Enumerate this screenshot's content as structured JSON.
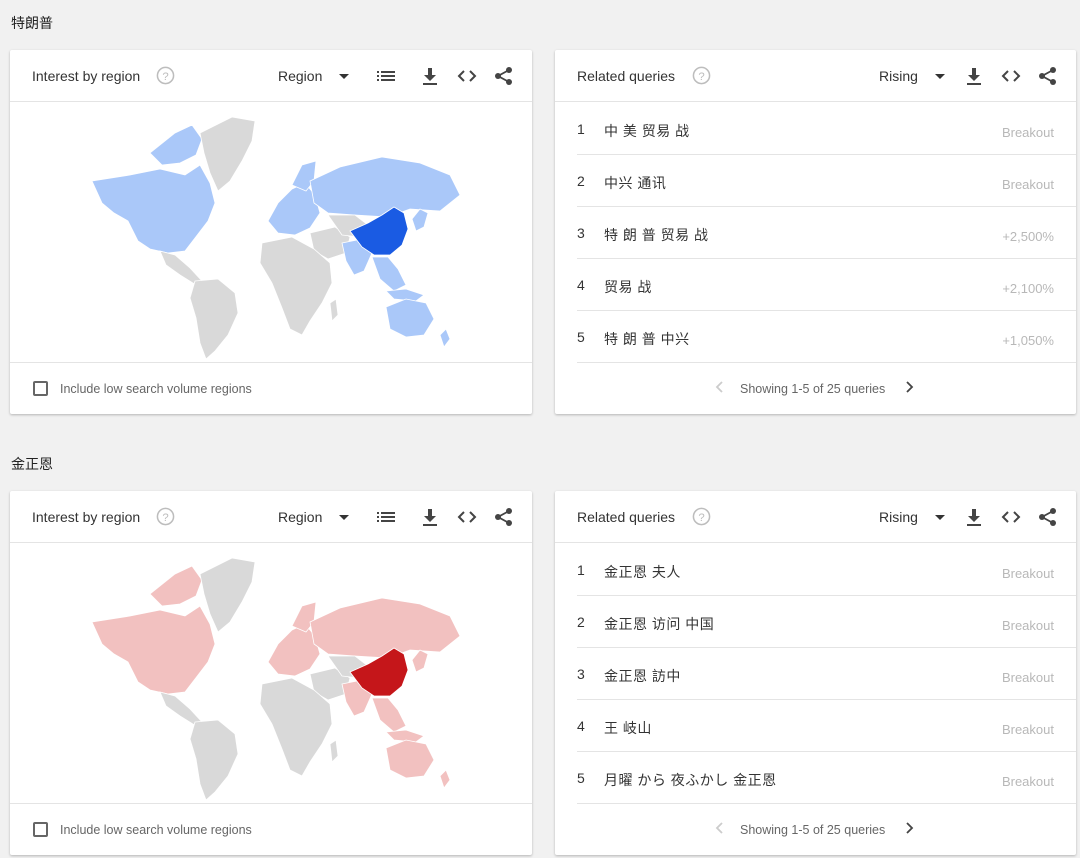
{
  "sections": [
    {
      "title": "特朗普",
      "region_card": {
        "title": "Interest by region",
        "select_value": "Region",
        "checkbox_label": "Include low search volume regions",
        "colors": {
          "highlight": "#1a5be3",
          "light": "#aac8f9",
          "base": "#d9d9d9"
        }
      },
      "queries_card": {
        "title": "Related queries",
        "select_value": "Rising",
        "rows": [
          {
            "rank": "1",
            "text": "中 美 贸易 战",
            "value": "Breakout"
          },
          {
            "rank": "2",
            "text": "中兴 通讯",
            "value": "Breakout"
          },
          {
            "rank": "3",
            "text": "特 朗 普 贸易 战",
            "value": "+2,500%"
          },
          {
            "rank": "4",
            "text": "贸易 战",
            "value": "+2,100%"
          },
          {
            "rank": "5",
            "text": "特 朗 普 中兴",
            "value": "+1,050%"
          }
        ],
        "pager_text": "Showing 1-5 of 25 queries"
      }
    },
    {
      "title": "金正恩",
      "region_card": {
        "title": "Interest by region",
        "select_value": "Region",
        "checkbox_label": "Include low search volume regions",
        "colors": {
          "highlight": "#c5161a",
          "light": "#f2c1c0",
          "base": "#d9d9d9"
        }
      },
      "queries_card": {
        "title": "Related queries",
        "select_value": "Rising",
        "rows": [
          {
            "rank": "1",
            "text": "金正恩 夫人",
            "value": "Breakout"
          },
          {
            "rank": "2",
            "text": "金正恩 访问 中国",
            "value": "Breakout"
          },
          {
            "rank": "3",
            "text": "金正恩 訪中",
            "value": "Breakout"
          },
          {
            "rank": "4",
            "text": "王 岐山",
            "value": "Breakout"
          },
          {
            "rank": "5",
            "text": "月曜 から 夜ふかし 金正恩",
            "value": "Breakout"
          }
        ],
        "pager_text": "Showing 1-5 of 25 queries"
      }
    }
  ]
}
